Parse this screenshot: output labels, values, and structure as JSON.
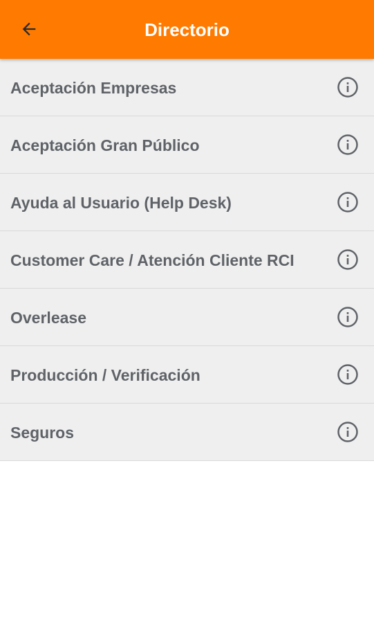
{
  "header": {
    "title": "Directorio",
    "background_color": "#ff7a00",
    "back_icon": "arrow-back-icon"
  },
  "items": [
    {
      "label": "Aceptación Empresas",
      "icon": "info-icon"
    },
    {
      "label": "Aceptación Gran Público",
      "icon": "info-icon"
    },
    {
      "label": "Ayuda al Usuario (Help Desk)",
      "icon": "info-icon"
    },
    {
      "label": "Customer Care / Atención Cliente RCI",
      "icon": "info-icon"
    },
    {
      "label": "Overlease",
      "icon": "info-icon"
    },
    {
      "label": "Producción / Verificación",
      "icon": "info-icon"
    },
    {
      "label": "Seguros",
      "icon": "info-icon"
    }
  ]
}
